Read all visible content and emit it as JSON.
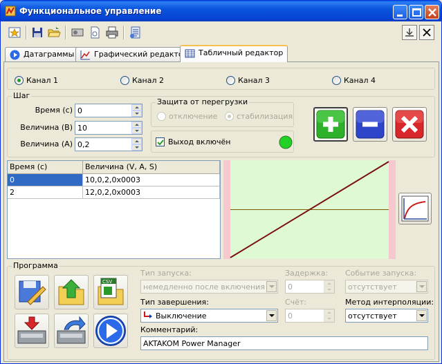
{
  "window": {
    "title": "Функциональное управление"
  },
  "colors": {
    "titlebar": "#0a54dc",
    "plus": "#2fb02a",
    "minus": "#2d45c8",
    "delete": "#d8262a",
    "indicator": "#22d122",
    "graph_bg": "#dff9d4",
    "graph_border": "#f7c9cf",
    "graph_line": "#7a1010",
    "graph_zero": "#7a5a00",
    "grid_selection": "#316ac5"
  },
  "tabs": [
    {
      "label": "Датаграммы",
      "icon": "play-circle-icon"
    },
    {
      "label": "Графический редактор",
      "icon": "chart-icon"
    },
    {
      "label": "Табличный редактор",
      "icon": "table-icon",
      "active": true
    }
  ],
  "channels": [
    {
      "label": "Канал 1",
      "selected": true
    },
    {
      "label": "Канал 2",
      "selected": false
    },
    {
      "label": "Канал 3",
      "selected": false
    },
    {
      "label": "Канал 4",
      "selected": false
    }
  ],
  "step": {
    "group_label": "Шаг",
    "time_label": "Время (с)",
    "time_value": "0",
    "magnitude_v_label": "Величина (В)",
    "magnitude_v_value": "10",
    "magnitude_a_label": "Величина (А)",
    "magnitude_a_value": "0,2"
  },
  "protection": {
    "group_label": "Защита от перегрузки",
    "off_label": "отключение",
    "stab_label": "стабилизация",
    "output_label": "Выход включён",
    "output_checked": true
  },
  "table": {
    "columns": [
      "Время (с)",
      "Величина (V, A, S)"
    ],
    "rows": [
      [
        "0",
        "10,0,2,0x0003"
      ],
      [
        "2",
        "12,0,2,0x0003"
      ]
    ]
  },
  "graph": {
    "line": {
      "x": [
        0,
        2
      ],
      "y": [
        10,
        12
      ]
    }
  },
  "program": {
    "group_label": "Программа",
    "start_type_label": "Тип запуска:",
    "start_type_value": "немедленно после включения",
    "delay_label": "Задержка:",
    "delay_value": "0",
    "start_event_label": "Событие запуска:",
    "start_event_value": "отсутствует",
    "end_type_label": "Тип завершения:",
    "end_type_value": "Выключение",
    "count_label": "Счёт:",
    "count_value": "0",
    "interp_label": "Метод интерполяции:",
    "interp_value": "отсутствует",
    "comment_label": "Комментарий:",
    "comment_value": "AKTAKOM Power Manager"
  }
}
